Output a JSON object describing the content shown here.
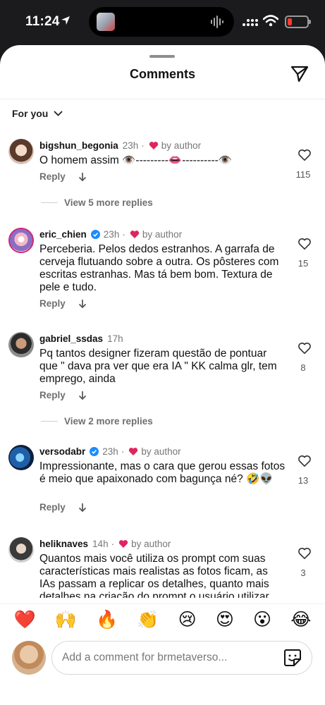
{
  "status_bar": {
    "time": "11:24"
  },
  "sheet": {
    "title": "Comments",
    "filter_label": "For you"
  },
  "comments": [
    {
      "username": "bigshun_begonia",
      "time": "23h",
      "author_label": "by author",
      "verified": false,
      "text": "O homem assim 👁️---------👄----------👁️",
      "reply_label": "Reply",
      "likes": "115",
      "more_replies": "View 5 more replies"
    },
    {
      "username": "eric_chien",
      "time": "23h",
      "author_label": "by author",
      "verified": true,
      "text": "Perceberia. Pelos dedos estranhos. A garrafa de cerveja flutuando sobre a outra. Os pôsteres com escritas estranhas. Mas tá bem bom. Textura de pele e tudo.",
      "reply_label": "Reply",
      "likes": "15"
    },
    {
      "username": "gabriel_ssdas",
      "time": "17h",
      "verified": false,
      "text": "Pq tantos designer fizeram questão de pontuar que \" dava pra ver que era IA \" KK calma glr, tem emprego, ainda",
      "reply_label": "Reply",
      "likes": "8",
      "more_replies": "View 2 more replies"
    },
    {
      "username": "versodabr",
      "time": "23h",
      "author_label": "by author",
      "verified": true,
      "text": "Impressionante, mas o cara que gerou essas fotos é meio que apaixonado com bagunça né? 🤣👽",
      "reply_label": "Reply",
      "likes": "13"
    },
    {
      "username": "heliknaves",
      "time": "14h",
      "author_label": "by author",
      "verified": false,
      "text": "Quantos mais você utiliza os prompt com suas características mais realistas as fotos ficam, as IAs passam a replicar os detalhes, quanto mais detalhes na criação do prompt o usuário utilizar",
      "likes": "3"
    }
  ],
  "emoji_bar": [
    "❤️",
    "🙌",
    "🔥",
    "👏",
    "😢",
    "😍",
    "😮",
    "😂"
  ],
  "input": {
    "placeholder": "Add a comment for brmetaverso..."
  }
}
